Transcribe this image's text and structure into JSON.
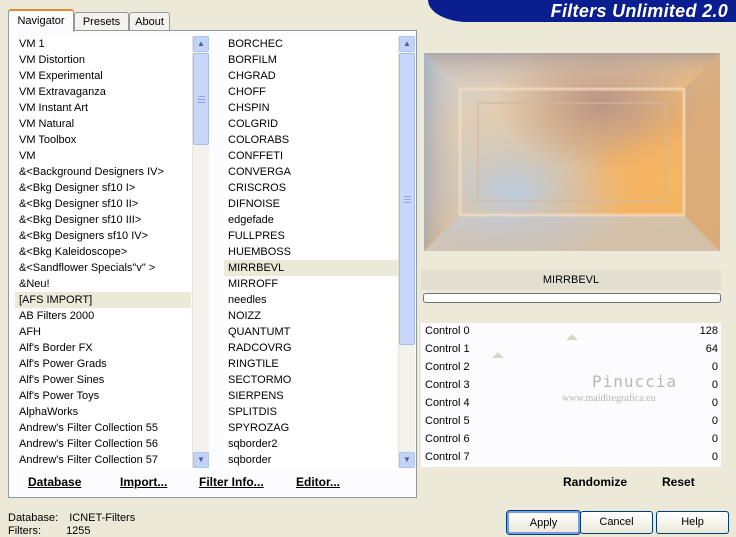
{
  "header": {
    "title": "Filters Unlimited 2.0"
  },
  "tabs": [
    {
      "label": "Navigator",
      "active": true
    },
    {
      "label": "Presets",
      "active": false
    },
    {
      "label": "About",
      "active": false
    }
  ],
  "categories": {
    "items": [
      "VM 1",
      "VM Distortion",
      "VM Experimental",
      "VM Extravaganza",
      "VM Instant Art",
      "VM Natural",
      "VM Toolbox",
      "VM",
      "&<Background Designers IV>",
      "&<Bkg Designer sf10 I>",
      "&<Bkg Designer sf10 II>",
      "&<Bkg Designer sf10 III>",
      "&<Bkg Designers sf10 IV>",
      "&<Bkg Kaleidoscope>",
      "&<Sandflower Specials\"v\" >",
      "&Neu!",
      "[AFS IMPORT]",
      "AB Filters 2000",
      "AFH",
      "Alf's Border FX",
      "Alf's Power Grads",
      "Alf's Power Sines",
      "Alf's Power Toys",
      "AlphaWorks",
      "Andrew's Filter Collection 55",
      "Andrew's Filter Collection 56",
      "Andrew's Filter Collection 57"
    ],
    "selected": "[AFS IMPORT]"
  },
  "filters": {
    "items": [
      "BORCHEC",
      "BORFILM",
      "CHGRAD",
      "CHOFF",
      "CHSPIN",
      "COLGRID",
      "COLORABS",
      "CONFFETI",
      "CONVERGA",
      "CRISCROS",
      "DIFNOISE",
      "edgefade",
      "FULLPRES",
      "HUEMBOSS",
      "MIRRBEVL",
      "MIRROFF",
      "needles",
      "NOIZZ",
      "QUANTUMT",
      "RADCOVRG",
      "RINGTILE",
      "SECTORMO",
      "SIERPENS",
      "SPLITDIS",
      "SPYROZAG",
      "sqborder2",
      "sqborder"
    ],
    "selected": "MIRRBEVL"
  },
  "toolbar": {
    "database": "Database",
    "import": "Import...",
    "filter_info": "Filter Info...",
    "editor": "Editor..."
  },
  "effect": {
    "name": "MIRRBEVL"
  },
  "controls": [
    {
      "label": "Control 0",
      "value": "128"
    },
    {
      "label": "Control 1",
      "value": "64"
    },
    {
      "label": "Control 2",
      "value": "0"
    },
    {
      "label": "Control 3",
      "value": "0"
    },
    {
      "label": "Control 4",
      "value": "0"
    },
    {
      "label": "Control 5",
      "value": "0"
    },
    {
      "label": "Control 6",
      "value": "0"
    },
    {
      "label": "Control 7",
      "value": "0"
    }
  ],
  "watermark": {
    "name": "Pinuccia",
    "site": "www.maidiregrafica.eu"
  },
  "right_actions": {
    "randomize": "Randomize",
    "reset": "Reset"
  },
  "info": {
    "database_label": "Database:",
    "database_value": "ICNET-Filters",
    "filters_label": "Filters:",
    "filters_value": "1255"
  },
  "buttons": {
    "apply": "Apply",
    "cancel": "Cancel",
    "help": "Help"
  },
  "icons": {
    "scroll_up": "chevron-up-icon",
    "scroll_down": "chevron-down-icon"
  }
}
